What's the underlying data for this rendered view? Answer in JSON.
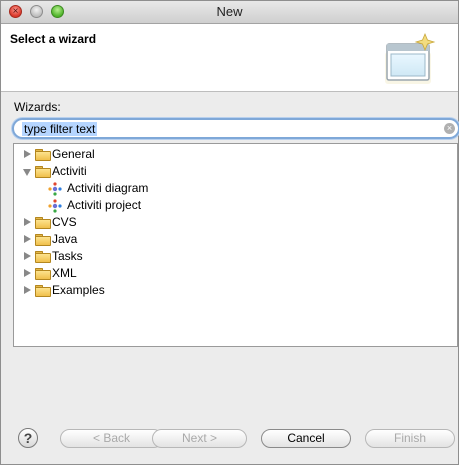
{
  "window": {
    "title": "New"
  },
  "banner": {
    "title": "Select a wizard",
    "icon": "wizard-banner-icon"
  },
  "wizards": {
    "label": "Wizards:",
    "filter": {
      "value": "type filter text"
    }
  },
  "tree": {
    "items": [
      {
        "label": "General",
        "icon": "folder-icon",
        "state": "collapsed"
      },
      {
        "label": "Activiti",
        "icon": "folder-icon",
        "state": "expanded"
      },
      {
        "label": "Activiti diagram",
        "icon": "activiti-icon",
        "state": "leaf"
      },
      {
        "label": "Activiti project",
        "icon": "activiti-icon",
        "state": "leaf"
      },
      {
        "label": "CVS",
        "icon": "folder-icon",
        "state": "collapsed"
      },
      {
        "label": "Java",
        "icon": "folder-icon",
        "state": "collapsed"
      },
      {
        "label": "Tasks",
        "icon": "folder-icon",
        "state": "collapsed"
      },
      {
        "label": "XML",
        "icon": "folder-icon",
        "state": "collapsed"
      },
      {
        "label": "Examples",
        "icon": "folder-icon",
        "state": "collapsed"
      }
    ]
  },
  "footer": {
    "help": "?",
    "back": "< Back",
    "next": "Next >",
    "cancel": "Cancel",
    "finish": "Finish"
  }
}
